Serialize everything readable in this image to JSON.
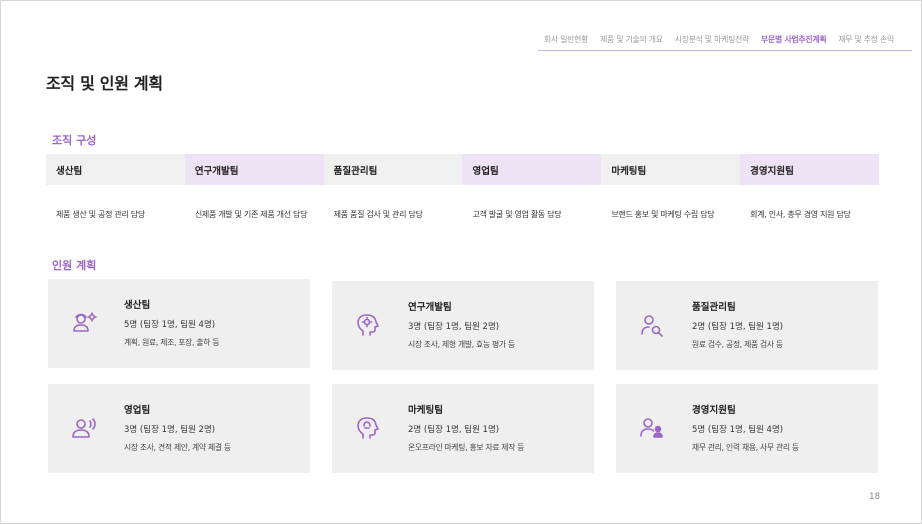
{
  "nav": {
    "items": [
      {
        "label": "회사 일반현황",
        "active": false
      },
      {
        "label": "제품 및 기술의 개요",
        "active": false
      },
      {
        "label": "시장분석 및 마케팅전략",
        "active": false
      },
      {
        "label": "부문별 사업추진계획",
        "active": true
      },
      {
        "label": "재무 및 추정 손익",
        "active": false
      }
    ]
  },
  "page_title": "조직 및 인원 계획",
  "sections": {
    "org": "조직 구성",
    "staff": "인원 계획"
  },
  "org_table": {
    "teams": [
      {
        "name": "생산팀",
        "duty": "제품 생산 및 공정 관리 담당"
      },
      {
        "name": "연구개발팀",
        "duty": "신제품 개발 및 기존 제품 개선 담당"
      },
      {
        "name": "품질관리팀",
        "duty": "제품 품질 검사 및 관리 담당"
      },
      {
        "name": "영업팀",
        "duty": "고객 발굴 및 영업 활동 담당"
      },
      {
        "name": "마케팅팀",
        "duty": "브랜드 홍보 및 마케팅 수립 담당"
      },
      {
        "name": "경영지원팀",
        "duty": "회계, 인사, 총무 경영 지원 담당"
      }
    ]
  },
  "staff_cards": [
    {
      "name": "생산팀",
      "count": "5명 (팀장 1명, 팀원 4명)",
      "duty": "계획, 원료, 제조, 포장, 출하 등",
      "icon": "worker-gear-icon"
    },
    {
      "name": "연구개발팀",
      "count": "3명 (팀장 1명, 팀원 2명)",
      "duty": "시장 조사, 제형 개발, 효능 평가 등",
      "icon": "head-gear-icon"
    },
    {
      "name": "품질관리팀",
      "count": "2명 (팀장 1명, 팀원 1명)",
      "duty": "원료 검수, 공정, 제품 검사 등",
      "icon": "person-search-icon"
    },
    {
      "name": "영업팀",
      "count": "3명 (팀장 1명, 팀원 2명)",
      "duty": "시장 조사, 견적 제안, 계약 체결 등",
      "icon": "person-speaking-icon"
    },
    {
      "name": "마케팅팀",
      "count": "2명 (팀장 1명, 팀원 1명)",
      "duty": "온오프라인 마케팅, 홍보 자료 제작 등",
      "icon": "head-idea-icon"
    },
    {
      "name": "경영지원팀",
      "count": "5명 (팀장 1명, 팀원 4명)",
      "duty": "재무 관리, 인력 채용, 사무 관리 등",
      "icon": "people-support-icon"
    }
  ],
  "page_number": "18",
  "colors": {
    "accent": "#9c67c4",
    "header_gray": "#f0f0f0",
    "header_purple": "#ede3f4",
    "card_bg": "#efefef"
  }
}
